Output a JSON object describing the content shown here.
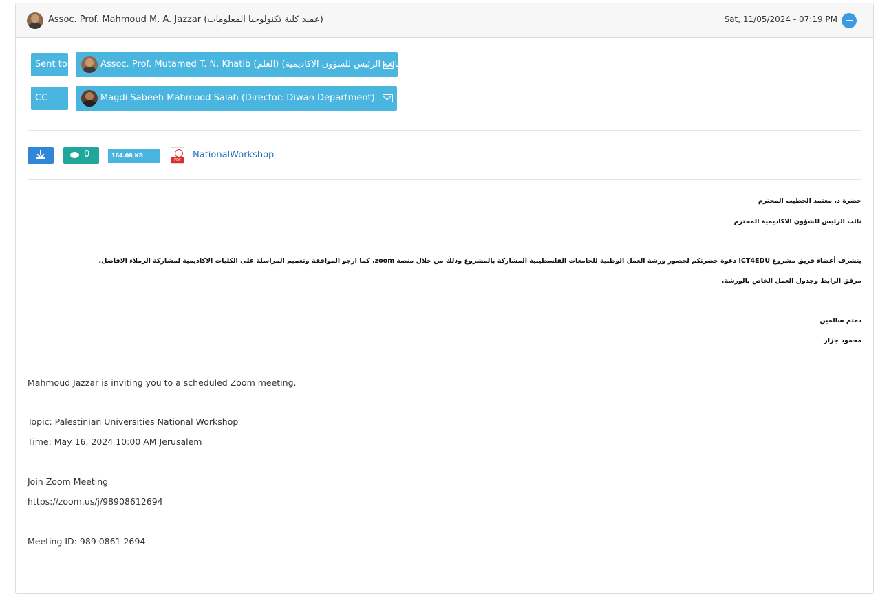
{
  "header": {
    "sender": "Assoc. Prof. Mahmoud M. A. Jazzar (عميد كلية تكنولوجيا المعلومات)",
    "date": "Sat, 11/05/2024 - 07:19 PM"
  },
  "recipients": {
    "sent_to_label": "Sent to",
    "sent_to_name": "Assoc. Prof. Mutamed T. N. Khatib (العلم) (نائب الرئيس للشؤون الاكاديمية)",
    "cc_label": "CC",
    "cc_name": "Magdi Sabeeh Mahmood Salah (Director: Diwan Department)"
  },
  "attachment": {
    "comment_count": "0",
    "size": "164.08 KB",
    "pdf_tag": "PDF",
    "file_name": "NationalWorkshop"
  },
  "arabic_body": {
    "greeting": "حضرة د. معتمد الخطيب المحترم",
    "title": "نائب الرئيس للشؤون الاكاديمية المحترم",
    "para1": "يتشرف أعضاء فريق مشروع ICT4EDU دعوة حضرتكم لحضور ورشة العمل الوطنية للجامعات الفلسطينية المشاركة بالمشروع وذلك من خلال منصة zoom. كما ارجو الموافقة وتعميم المراسلة على الكليات الاكاديمية لمشاركة الزملاء الافاضل.",
    "para2": "مرفق الرابط وجدول العمل الخاص بالورشة.",
    "closing": "دمتم سالمين",
    "signature": "محمود جزار"
  },
  "english_body": {
    "invite": "Mahmoud Jazzar is inviting you to a scheduled Zoom meeting.",
    "topic": "Topic: Palestinian Universities National Workshop",
    "time": "Time: May 16, 2024 10:00 AM Jerusalem",
    "join": "Join Zoom Meeting",
    "link": "https://zoom.us/j/98908612694",
    "meeting_id": "Meeting ID: 989 0861 2694"
  }
}
